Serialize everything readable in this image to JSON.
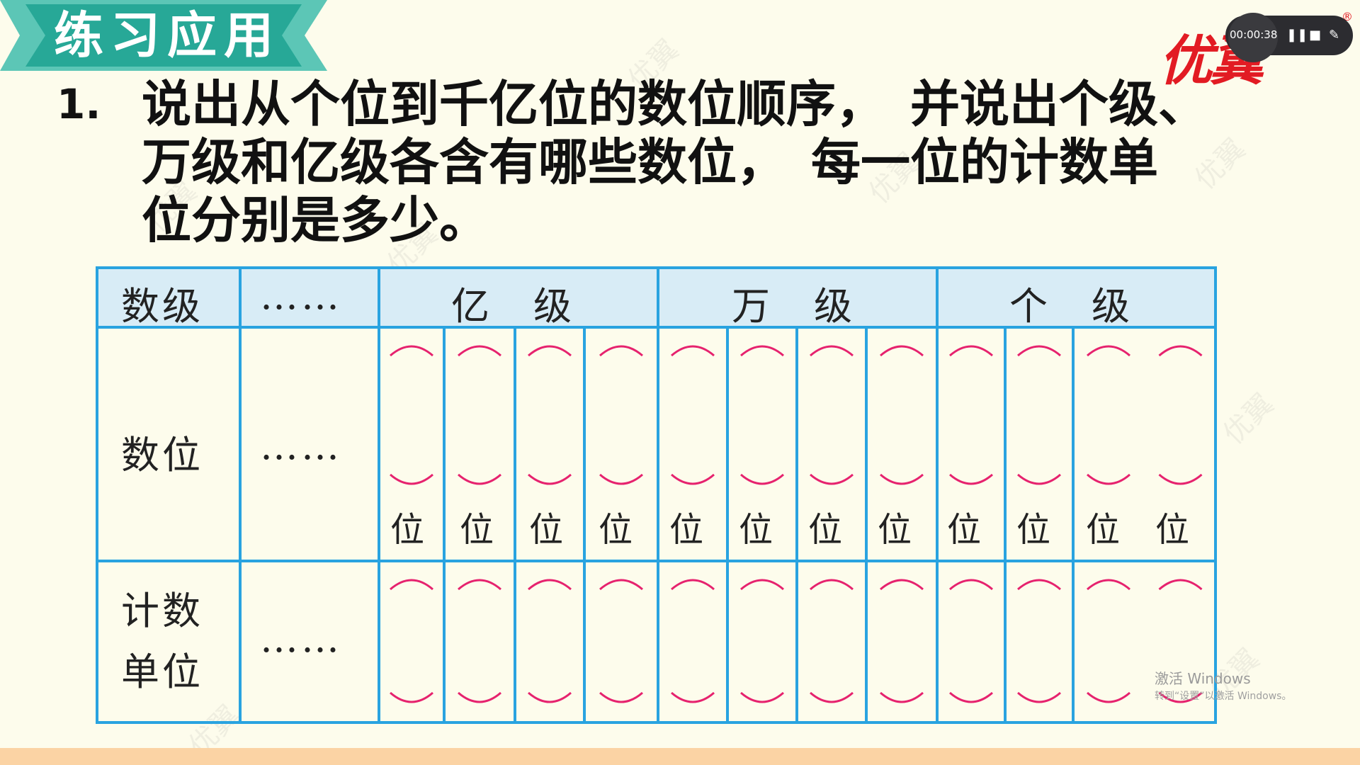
{
  "banner": {
    "title": "练习应用"
  },
  "logo": {
    "text": "优翼",
    "reg": "®"
  },
  "recorder": {
    "time": "00:00:38",
    "pause_icon": "pause-icon",
    "stop_icon": "stop-icon",
    "pen_icon": "pen-icon"
  },
  "question": {
    "number": "1.",
    "lines": [
      "说出从个位到千亿位的数位顺序，　并说出个级、",
      "万级和亿级各含有哪些数位，　每一位的计数单",
      "位分别是多少。"
    ]
  },
  "table": {
    "header": {
      "label": "数级",
      "ellipsis": "……",
      "yi": "亿　级",
      "wan": "万　级",
      "ge": "个　级"
    },
    "row_digits": {
      "label": "数位",
      "ellipsis": "……",
      "suffix": "位"
    },
    "row_units": {
      "label_line1": "计数",
      "label_line2": "单位",
      "ellipsis": "……"
    },
    "colors": {
      "border": "#29a3e0",
      "header_bg": "#d8ecf6",
      "bracket": "#e6226e"
    }
  },
  "watermark": {
    "text": "优翼"
  },
  "activate": {
    "title": "激活 Windows",
    "subtitle": "转到“设置”以激活 Windows。"
  }
}
